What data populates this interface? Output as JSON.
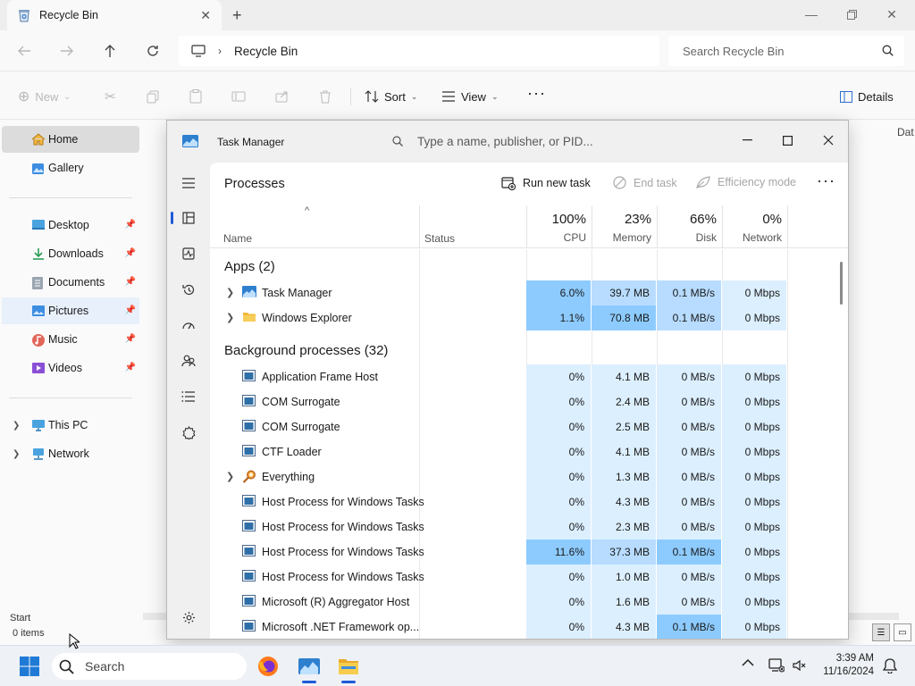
{
  "explorer": {
    "tab_title": "Recycle Bin",
    "breadcrumb": "Recycle Bin",
    "search_placeholder": "Search Recycle Bin",
    "cmd": {
      "new": "New",
      "sort": "Sort",
      "view": "View",
      "details": "Details"
    },
    "column_peek": "Dat",
    "nav": {
      "home": "Home",
      "gallery": "Gallery",
      "desktop": "Desktop",
      "downloads": "Downloads",
      "documents": "Documents",
      "pictures": "Pictures",
      "music": "Music",
      "videos": "Videos",
      "this_pc": "This PC",
      "network": "Network"
    },
    "status_tooltip": "Start",
    "status_items": "0 items"
  },
  "taskmgr": {
    "title": "Task Manager",
    "search_placeholder": "Type a name, publisher, or PID...",
    "page_title": "Processes",
    "run_new_task": "Run new task",
    "end_task": "End task",
    "efficiency_mode": "Efficiency mode",
    "columns": {
      "name": "Name",
      "status": "Status",
      "cpu_pct": "100%",
      "cpu": "CPU",
      "mem_pct": "23%",
      "mem": "Memory",
      "disk_pct": "66%",
      "disk": "Disk",
      "net_pct": "0%",
      "net": "Network"
    },
    "groups": {
      "apps": "Apps (2)",
      "background": "Background processes (32)"
    },
    "apps": [
      {
        "name": "Task Manager",
        "cpu": "6.0%",
        "mem": "39.7 MB",
        "disk": "0.1 MB/s",
        "net": "0 Mbps"
      },
      {
        "name": "Windows Explorer",
        "cpu": "1.1%",
        "mem": "70.8 MB",
        "disk": "0.1 MB/s",
        "net": "0 Mbps"
      }
    ],
    "background": [
      {
        "name": "Application Frame Host",
        "cpu": "0%",
        "mem": "4.1 MB",
        "disk": "0 MB/s",
        "net": "0 Mbps"
      },
      {
        "name": "COM Surrogate",
        "cpu": "0%",
        "mem": "2.4 MB",
        "disk": "0 MB/s",
        "net": "0 Mbps"
      },
      {
        "name": "COM Surrogate",
        "cpu": "0%",
        "mem": "2.5 MB",
        "disk": "0 MB/s",
        "net": "0 Mbps"
      },
      {
        "name": "CTF Loader",
        "cpu": "0%",
        "mem": "4.1 MB",
        "disk": "0 MB/s",
        "net": "0 Mbps"
      },
      {
        "name": "Everything",
        "cpu": "0%",
        "mem": "1.3 MB",
        "disk": "0 MB/s",
        "net": "0 Mbps"
      },
      {
        "name": "Host Process for Windows Tasks",
        "cpu": "0%",
        "mem": "4.3 MB",
        "disk": "0 MB/s",
        "net": "0 Mbps"
      },
      {
        "name": "Host Process for Windows Tasks",
        "cpu": "0%",
        "mem": "2.3 MB",
        "disk": "0 MB/s",
        "net": "0 Mbps"
      },
      {
        "name": "Host Process for Windows Tasks",
        "cpu": "11.6%",
        "mem": "37.3 MB",
        "disk": "0.1 MB/s",
        "net": "0 Mbps"
      },
      {
        "name": "Host Process for Windows Tasks",
        "cpu": "0%",
        "mem": "1.0 MB",
        "disk": "0 MB/s",
        "net": "0 Mbps"
      },
      {
        "name": "Microsoft (R) Aggregator Host",
        "cpu": "0%",
        "mem": "1.6 MB",
        "disk": "0 MB/s",
        "net": "0 Mbps"
      },
      {
        "name": "Microsoft .NET Framework op...",
        "cpu": "0%",
        "mem": "4.3 MB",
        "disk": "0.1 MB/s",
        "net": "0 Mbps"
      }
    ]
  },
  "taskbar": {
    "search_placeholder": "Search",
    "time": "3:39 AM",
    "date": "11/16/2024"
  },
  "colors": {
    "heat_low": "#dcefff",
    "heat_mid": "#b8dcff",
    "heat_high": "#8dcbff",
    "accent": "#1f5bd8"
  }
}
